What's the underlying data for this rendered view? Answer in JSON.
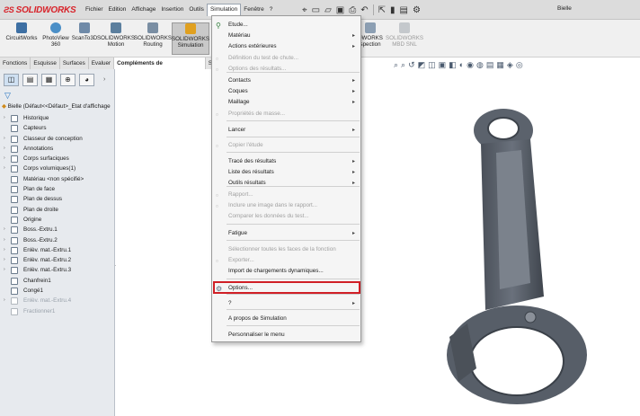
{
  "app": {
    "logo": "SOLIDWORKS",
    "doc_title": "Bielle"
  },
  "menubar": [
    "Fichier",
    "Edition",
    "Affichage",
    "Insertion",
    "Outils",
    "Simulation",
    "Fenêtre",
    "?"
  ],
  "commands": [
    {
      "label": "CircuitWorks"
    },
    {
      "label": "PhotoView\n360"
    },
    {
      "label": "ScanTo3D"
    },
    {
      "label": "SOLIDWORKS\nMotion"
    },
    {
      "label": "SOLIDWORKS\nRouting"
    },
    {
      "label": "SOLIDWORKS\nSimulation"
    },
    {
      "label": "DWORKS\nspection"
    },
    {
      "label": "SOLIDWORKS\nMBD SNL"
    }
  ],
  "tabs": [
    "Fonctions",
    "Esquisse",
    "Surfaces",
    "Evaluer",
    "Compléments de SOLIDWORKS",
    "S"
  ],
  "tree": {
    "root": "Bielle  (Défaut<<Défaut>_Etat d'affichage",
    "items": [
      {
        "label": "Historique",
        "dim": false
      },
      {
        "label": "Capteurs",
        "dim": false
      },
      {
        "label": "Classeur de conception",
        "dim": false
      },
      {
        "label": "Annotations",
        "dim": false
      },
      {
        "label": "Corps surfaciques",
        "dim": false
      },
      {
        "label": "Corps volumiques(1)",
        "dim": false
      },
      {
        "label": "Matériau <non spécifié>",
        "dim": false
      },
      {
        "label": "Plan de face",
        "dim": false
      },
      {
        "label": "Plan de dessus",
        "dim": false
      },
      {
        "label": "Plan de droite",
        "dim": false
      },
      {
        "label": "Origine",
        "dim": false
      },
      {
        "label": "Boss.-Extru.1",
        "dim": false
      },
      {
        "label": "Boss.-Extru.2",
        "dim": false
      },
      {
        "label": "Enlèv. mat.-Extru.1",
        "dim": false
      },
      {
        "label": "Enlèv. mat.-Extru.2",
        "dim": false
      },
      {
        "label": "Enlèv. mat.-Extru.3",
        "dim": false
      },
      {
        "label": "Chanfrein1",
        "dim": false
      },
      {
        "label": "Congé1",
        "dim": false
      },
      {
        "label": "Enlèv. mat.-Extru.4",
        "dim": true
      },
      {
        "label": "Fractionner1",
        "dim": true
      }
    ]
  },
  "simulation_menu": {
    "items": [
      {
        "label": "Etude...",
        "disabled": false,
        "submenu": false
      },
      {
        "label": "Matériau",
        "disabled": false,
        "submenu": true
      },
      {
        "label": "Actions extérieures",
        "disabled": false,
        "submenu": true
      },
      {
        "label": "Définition du test de chute...",
        "disabled": true,
        "submenu": false
      },
      {
        "label": "Options des résultats...",
        "disabled": true,
        "submenu": false
      },
      {
        "label": "Contacts",
        "disabled": false,
        "submenu": true
      },
      {
        "label": "Coques",
        "disabled": false,
        "submenu": true
      },
      {
        "label": "Maillage",
        "disabled": false,
        "submenu": true
      },
      {
        "label": "Propriétés de masse...",
        "disabled": true,
        "submenu": false
      },
      {
        "label": "Lancer",
        "disabled": false,
        "submenu": true
      },
      {
        "label": "Copier l'étude",
        "disabled": true,
        "submenu": false
      },
      {
        "label": "Tracé des résultats",
        "disabled": false,
        "submenu": true
      },
      {
        "label": "Liste des résultats",
        "disabled": false,
        "submenu": true
      },
      {
        "label": "Outils résultats",
        "disabled": false,
        "submenu": true
      },
      {
        "label": "Rapport...",
        "disabled": true,
        "submenu": false
      },
      {
        "label": "Inclure une image dans le rapport...",
        "disabled": true,
        "submenu": false
      },
      {
        "label": "Comparer les données du test...",
        "disabled": true,
        "submenu": false
      },
      {
        "label": "Fatigue",
        "disabled": false,
        "submenu": true
      },
      {
        "label": "Sélectionner toutes les faces de la fonction",
        "disabled": true,
        "submenu": false
      },
      {
        "label": "Exporter...",
        "disabled": true,
        "submenu": false
      },
      {
        "label": "Import de chargements dynamiques...",
        "disabled": false,
        "submenu": false
      },
      {
        "label": "Options...",
        "disabled": false,
        "submenu": false
      },
      {
        "label": "?",
        "disabled": false,
        "submenu": true
      },
      {
        "label": "A propos de Simulation",
        "disabled": false,
        "submenu": false
      },
      {
        "label": "Personnaliser le menu",
        "disabled": false,
        "submenu": false
      }
    ],
    "highlight_color": "#d01f26"
  },
  "icons": {
    "etude": "study-icon",
    "options": "gear-options-icon"
  },
  "colors": {
    "brand": "#d8232a",
    "part": "#5f6671",
    "highlight": "#d01f26"
  }
}
